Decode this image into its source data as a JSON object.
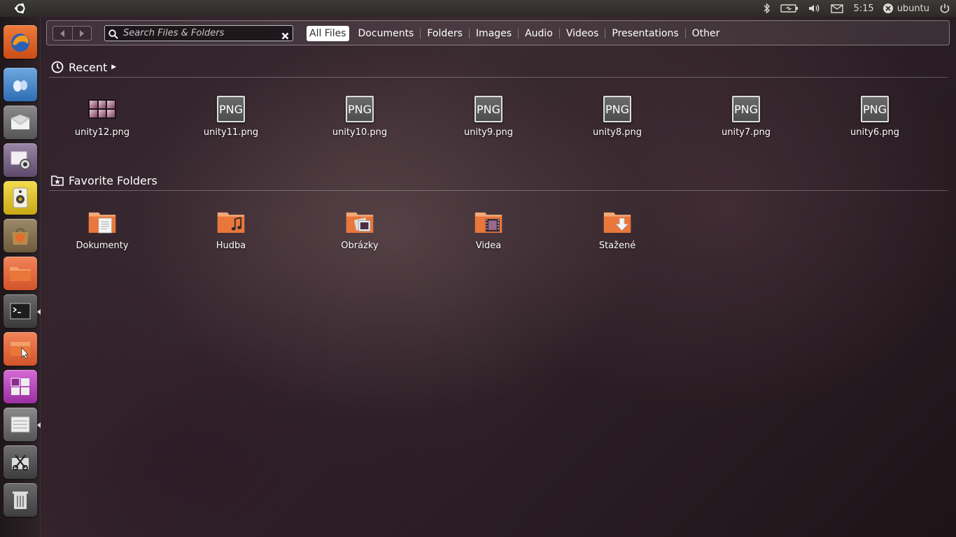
{
  "top_panel": {
    "clock": "5:15",
    "user": "ubuntu",
    "icons": [
      "ubuntu-logo-icon",
      "bluetooth-icon",
      "battery-icon",
      "volume-icon",
      "mail-icon",
      "user-status-icon",
      "power-icon"
    ]
  },
  "launcher": {
    "items": [
      "dash-home-icon",
      "firefox-icon",
      "empathy-icon",
      "mail-client-icon",
      "photo-viewer-icon",
      "speaker-icon",
      "software-center-icon",
      "files-icon",
      "terminal-icon",
      "folder-app-icon",
      "workspace-switcher-icon",
      "file-manager-icon",
      "screenshot-tool-icon",
      "trash-icon"
    ]
  },
  "dash": {
    "search": {
      "placeholder": "Search Files & Folders",
      "value": ""
    },
    "filters": [
      "All Files",
      "Documents",
      "Folders",
      "Images",
      "Audio",
      "Videos",
      "Presentations",
      "Other"
    ],
    "active_filter": "All Files"
  },
  "recent": {
    "title": "Recent",
    "items": [
      {
        "name": "unity12.png",
        "icon": "image-thumbnail-icon"
      },
      {
        "name": "unity11.png",
        "icon": "png-file-icon",
        "badge": "PNG"
      },
      {
        "name": "unity10.png",
        "icon": "png-file-icon",
        "badge": "PNG"
      },
      {
        "name": "unity9.png",
        "icon": "png-file-icon",
        "badge": "PNG"
      },
      {
        "name": "unity8.png",
        "icon": "png-file-icon",
        "badge": "PNG"
      },
      {
        "name": "unity7.png",
        "icon": "png-file-icon",
        "badge": "PNG"
      },
      {
        "name": "unity6.png",
        "icon": "png-file-icon",
        "badge": "PNG"
      }
    ]
  },
  "favorites": {
    "title": "Favorite Folders",
    "items": [
      {
        "name": "Dokumenty",
        "icon": "documents-folder-icon"
      },
      {
        "name": "Hudba",
        "icon": "music-folder-icon"
      },
      {
        "name": "Obrázky",
        "icon": "pictures-folder-icon"
      },
      {
        "name": "Videa",
        "icon": "videos-folder-icon"
      },
      {
        "name": "Stažené",
        "icon": "downloads-folder-icon"
      }
    ]
  }
}
